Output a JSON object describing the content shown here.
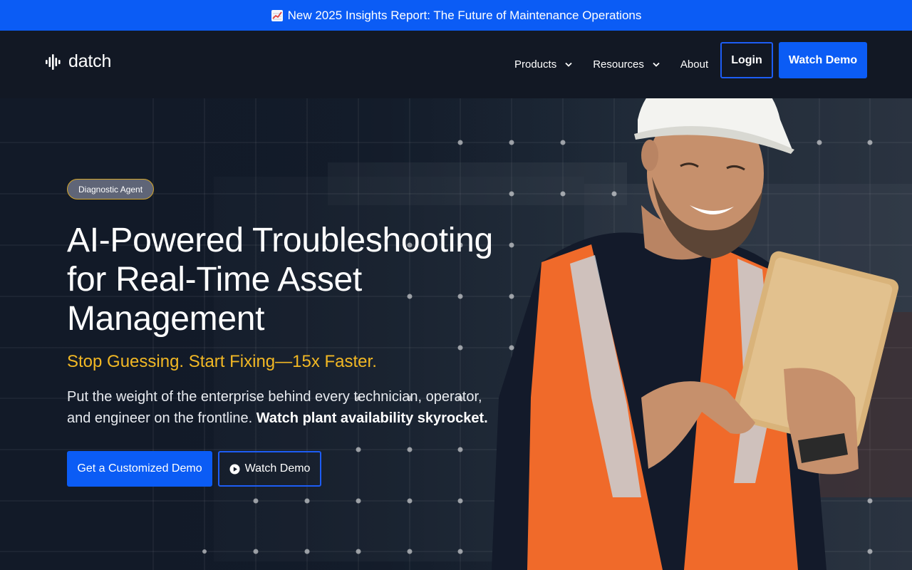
{
  "announcement": {
    "icon": "chart-increasing-icon",
    "text": "New 2025 Insights Report: The Future of Maintenance Operations"
  },
  "header": {
    "logo_text": "datch",
    "nav": [
      {
        "label": "Products",
        "has_dropdown": true
      },
      {
        "label": "Resources",
        "has_dropdown": true
      },
      {
        "label": "About",
        "has_dropdown": false
      }
    ],
    "login_label": "Login",
    "watch_demo_label": "Watch Demo"
  },
  "hero": {
    "badge": "Diagnostic Agent",
    "headline": "AI-Powered Troubleshooting for Real-Time Asset Management",
    "subheadline": "Stop Guessing. Start Fixing—15x Faster.",
    "body_plain": "Put the weight of the enterprise behind every technician, operator, and engineer on the frontline.",
    "body_bold": "Watch plant availability skyrocket.",
    "cta_primary": "Get a Customized Demo",
    "cta_secondary": "Watch Demo"
  },
  "colors": {
    "accent": "#0b5cf5",
    "announcement_bg": "#0b5cf5",
    "header_bg": "#121824",
    "subheadline": "#f2b824",
    "badge_border": "#d4a52a"
  }
}
